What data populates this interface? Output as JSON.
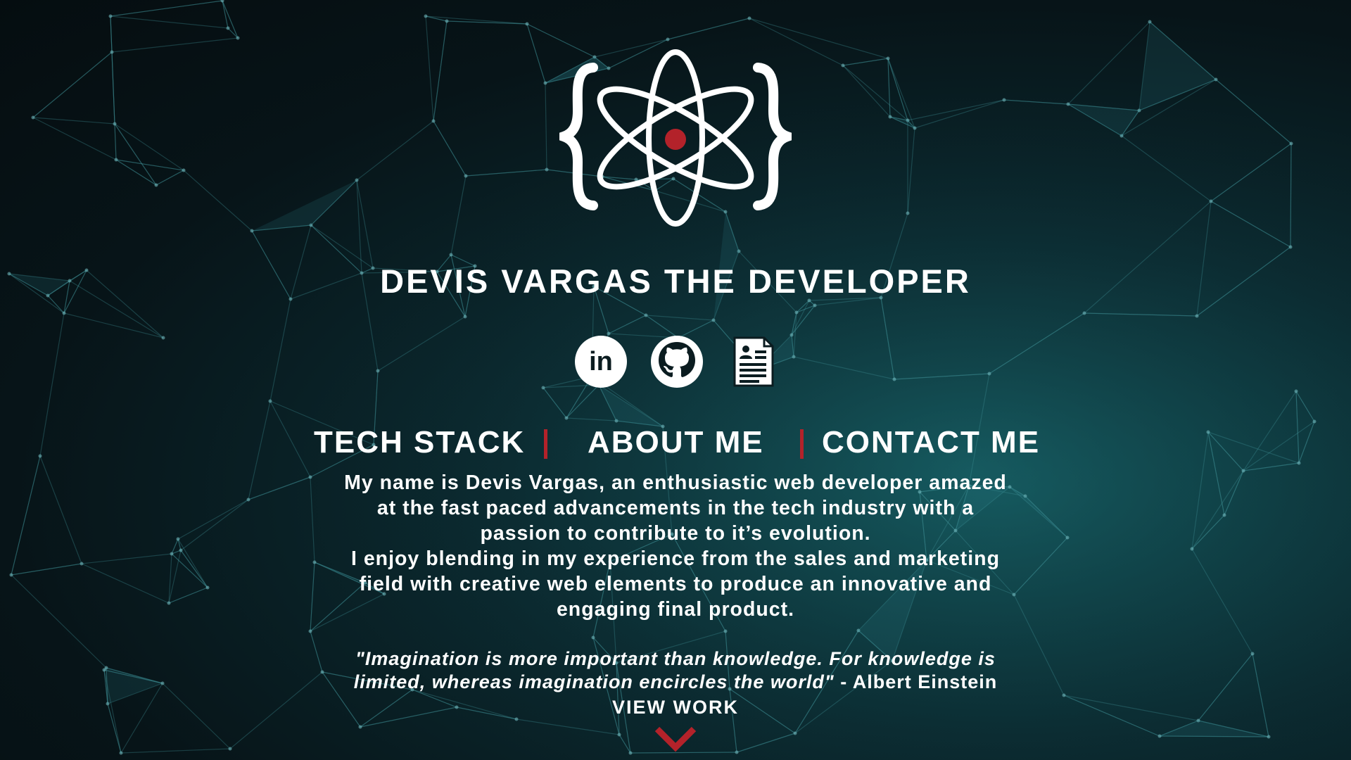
{
  "site": {
    "title": "DEVIS VARGAS THE DEVELOPER",
    "logo_icon": "atom-braces-icon",
    "accent_color": "#b3222a"
  },
  "social": [
    {
      "name": "linkedin-icon",
      "label": "in"
    },
    {
      "name": "github-icon"
    },
    {
      "name": "resume-icon"
    }
  ],
  "nav": {
    "tech_stack": "TECH STACK",
    "about_me": "ABOUT ME",
    "contact_me": "CONTACT ME"
  },
  "bio": {
    "line1": "My name is Devis Vargas, an enthusiastic web developer amazed",
    "line2": "at the fast paced advancements in the tech industry with a",
    "line3": "passion to contribute to it’s evolution.",
    "line4": "I enjoy blending in my experience from the sales and marketing",
    "line5": "field with creative web elements to produce an innovative and",
    "line6": "engaging final product."
  },
  "quote": {
    "line1": "\"Imagination is more important than knowledge. For knowledge is",
    "line2": "limited, whereas imagination encircles the world\"",
    "author": " - Albert Einstein"
  },
  "cta": {
    "view_work": "VIEW WORK",
    "icon": "chevron-down-icon"
  }
}
